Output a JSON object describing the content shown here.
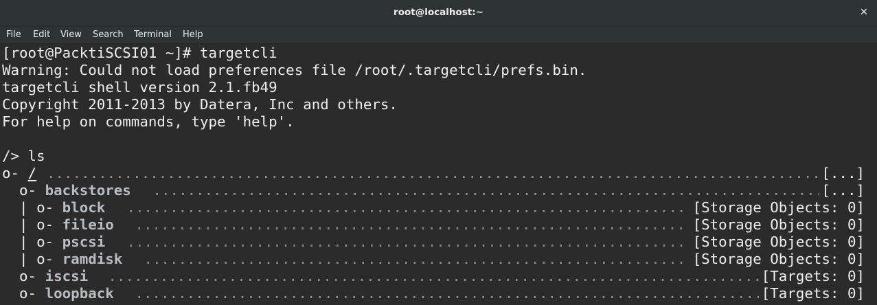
{
  "window": {
    "title": "root@localhost:~",
    "close_glyph": "✕"
  },
  "menubar": {
    "items": [
      "File",
      "Edit",
      "View",
      "Search",
      "Terminal",
      "Help"
    ]
  },
  "terminal": {
    "lines": [
      "[root@PacktiSCSI01 ~]# targetcli",
      "Warning: Could not load preferences file /root/.targetcli/prefs.bin.",
      "targetcli shell version 2.1.fb49",
      "Copyright 2011-2013 by Datera, Inc and others.",
      "For help on commands, type 'help'.",
      "",
      "/> ls"
    ],
    "tree": [
      {
        "prefix": "o- ",
        "name": "/",
        "info": "[...]"
      },
      {
        "prefix": "  o- ",
        "name": "backstores",
        "info": "[...]"
      },
      {
        "prefix": "  | o- ",
        "name": "block",
        "info": "[Storage Objects: 0]"
      },
      {
        "prefix": "  | o- ",
        "name": "fileio",
        "info": "[Storage Objects: 0]"
      },
      {
        "prefix": "  | o- ",
        "name": "pscsi",
        "info": "[Storage Objects: 0]"
      },
      {
        "prefix": "  | o- ",
        "name": "ramdisk",
        "info": "[Storage Objects: 0]"
      },
      {
        "prefix": "  o- ",
        "name": "iscsi",
        "info": "[Targets: 0]"
      },
      {
        "prefix": "  o- ",
        "name": "loopback",
        "info": "[Targets: 0]"
      }
    ]
  },
  "colors": {
    "titlebar_bg": "#2e3436",
    "terminal_bg": "#2b2b2b",
    "text": "#eeeeec",
    "node_text": "#b8bdc0"
  }
}
